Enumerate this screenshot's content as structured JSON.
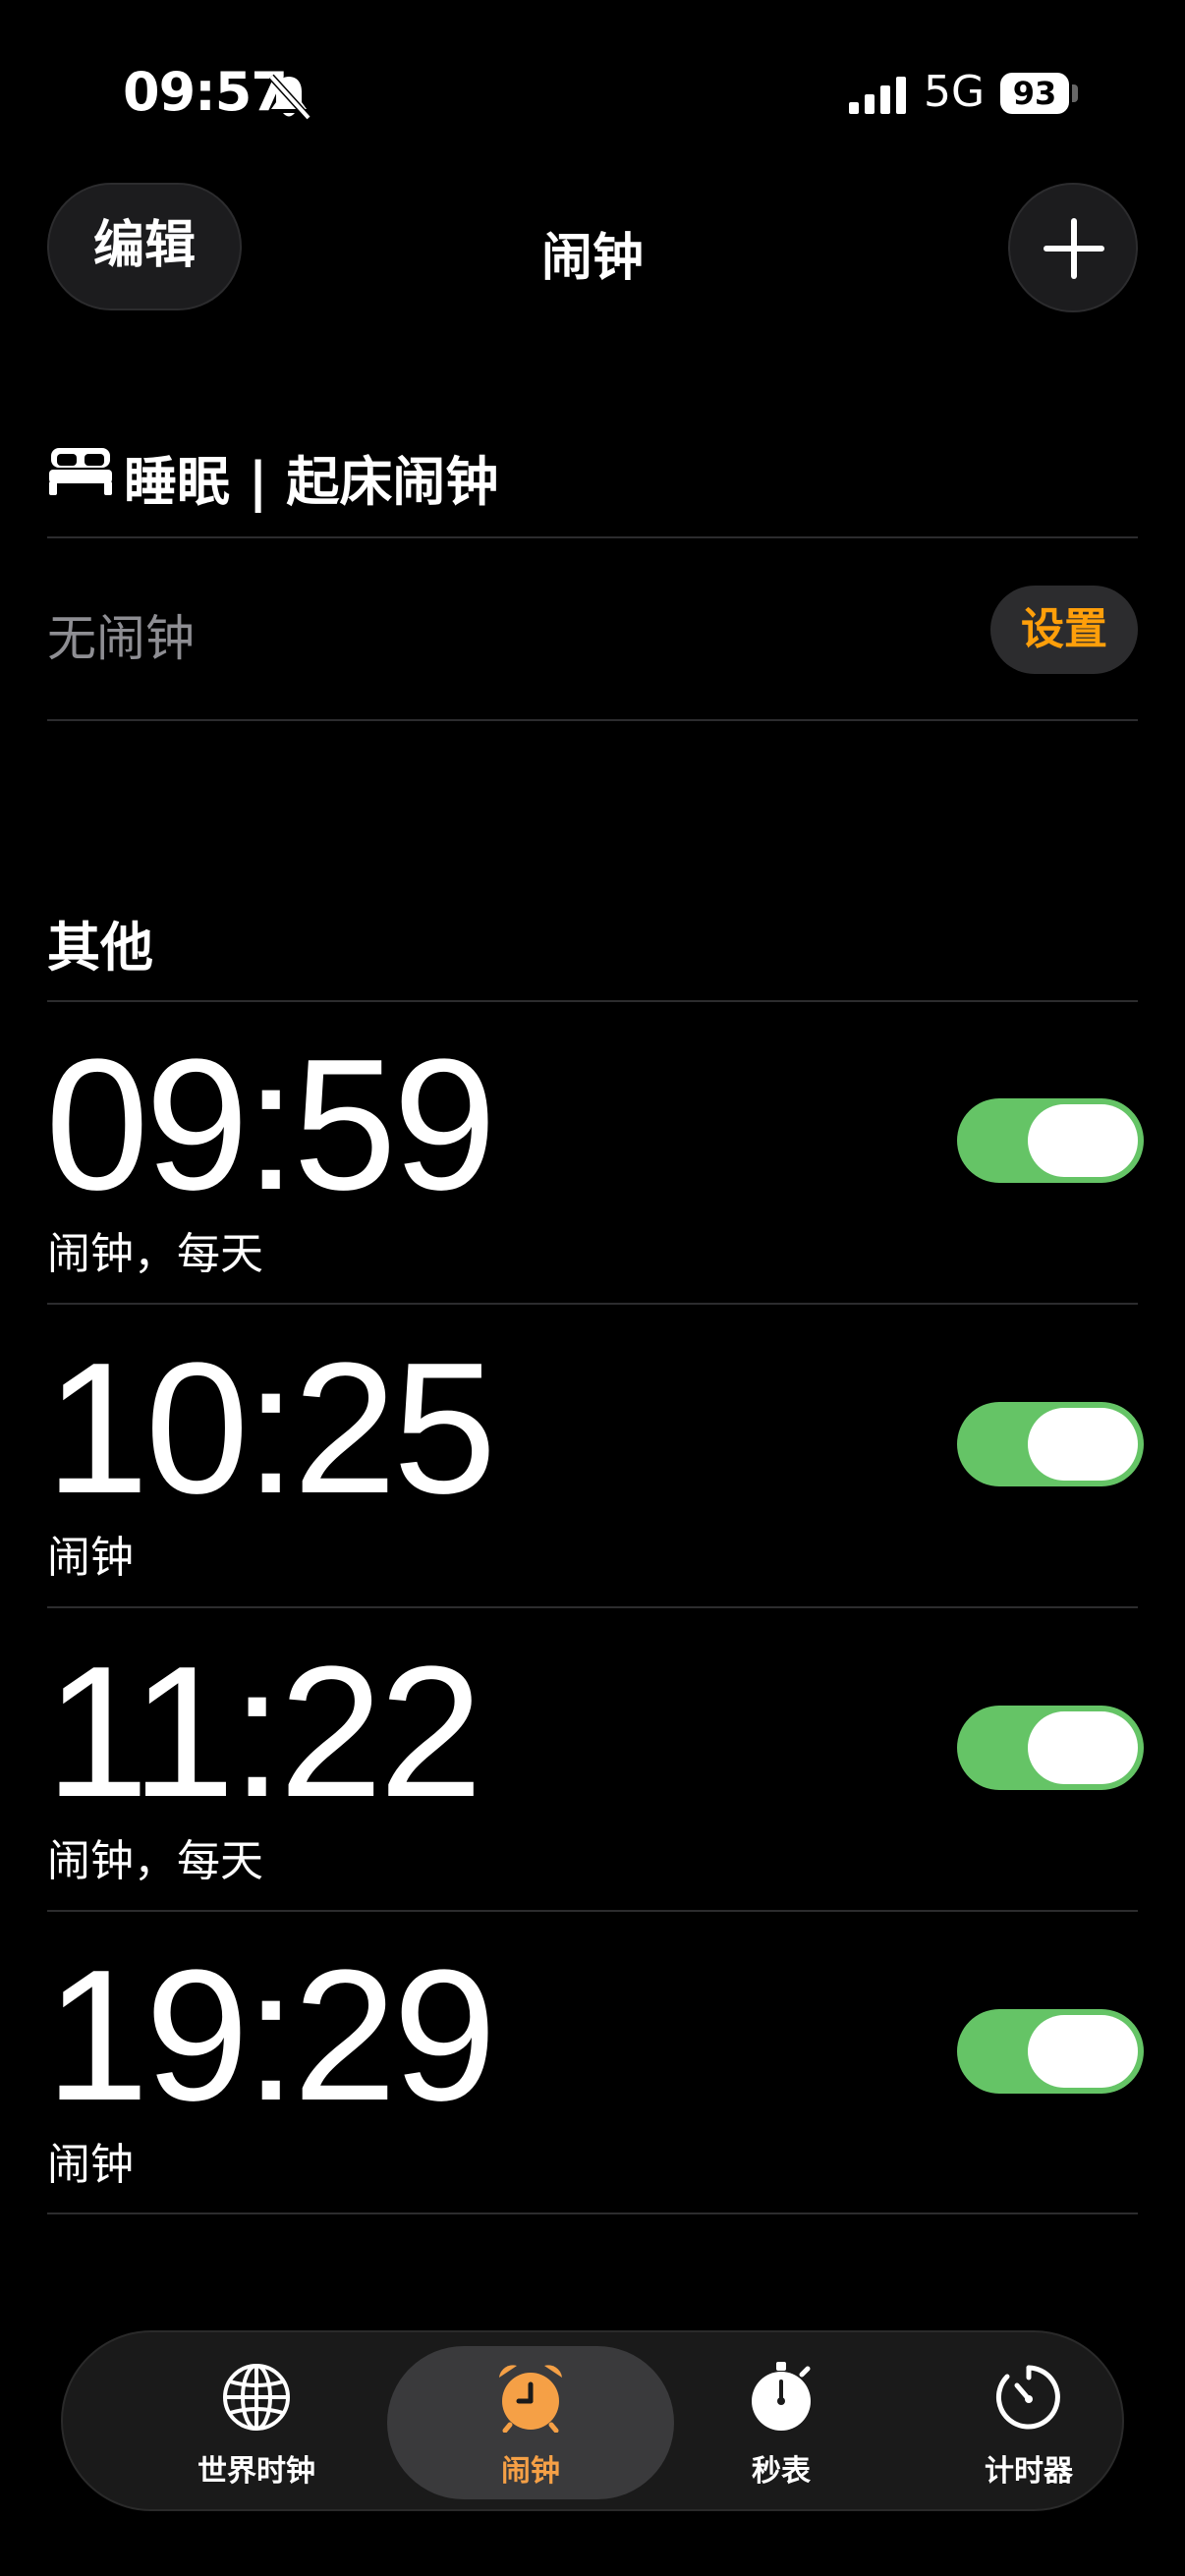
{
  "status_bar": {
    "time": "09:57",
    "network": "5G",
    "battery": "93",
    "icons": [
      "bell-off-icon",
      "signal-icon",
      "battery-icon"
    ]
  },
  "nav": {
    "edit_label": "编辑",
    "title": "闹钟",
    "add_icon": "plus-icon"
  },
  "sleep_section": {
    "title": "睡眠 | 起床闹钟",
    "icon": "bed-icon",
    "empty_text": "无闹钟",
    "set_label": "设置"
  },
  "other_section": {
    "title": "其他",
    "alarms": [
      {
        "time": "09:59",
        "label": "闹钟，每天",
        "enabled": true
      },
      {
        "time": "10:25",
        "label": "闹钟",
        "enabled": true
      },
      {
        "time": "11:22",
        "label": "闹钟，每天",
        "enabled": true
      },
      {
        "time": "19:29",
        "label": "闹钟",
        "enabled": true
      }
    ]
  },
  "tab_bar": {
    "tabs": [
      {
        "label": "世界时钟",
        "icon": "globe-icon",
        "active": false
      },
      {
        "label": "闹钟",
        "icon": "alarm-clock-icon",
        "active": true
      },
      {
        "label": "秒表",
        "icon": "stopwatch-icon",
        "active": false
      },
      {
        "label": "计时器",
        "icon": "timer-icon",
        "active": false
      }
    ]
  },
  "colors": {
    "accent": "#ff9f0a",
    "toggle_on": "#65c466",
    "active_tab": "#f5a046",
    "background": "#000000"
  }
}
